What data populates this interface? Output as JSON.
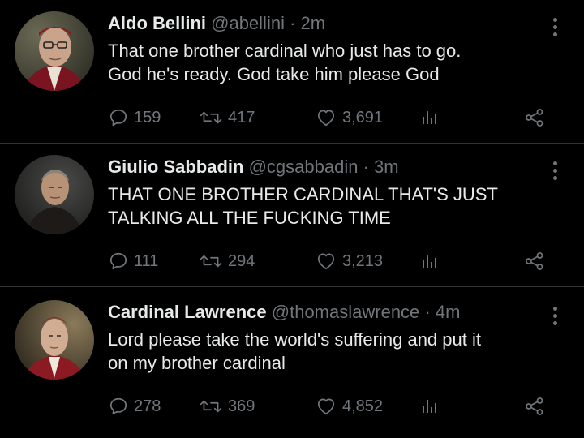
{
  "tweets": [
    {
      "name": "Aldo Bellini",
      "handle": "@abellini",
      "separator": "·",
      "time": "2m",
      "text_lines": [
        "That one brother cardinal who just has to go.",
        "God he's ready. God take him please God"
      ],
      "replies": "159",
      "retweets": "417",
      "likes": "3,691",
      "avatar_icon": "avatar-photo-aldo-bellini"
    },
    {
      "name": "Giulio Sabbadin",
      "handle": "@cgsabbadin",
      "separator": "·",
      "time": "3m",
      "text_lines": [
        "THAT ONE BROTHER CARDINAL THAT'S JUST",
        "TALKING ALL THE FUCKING TIME"
      ],
      "replies": "111",
      "retweets": "294",
      "likes": "3,213",
      "avatar_icon": "avatar-photo-giulio-sabbadin"
    },
    {
      "name": "Cardinal Lawrence",
      "handle": "@thomaslawrence",
      "separator": "·",
      "time": "4m",
      "text_lines": [
        "Lord please take the world's suffering and put it",
        "on my brother cardinal"
      ],
      "replies": "278",
      "retweets": "369",
      "likes": "4,852",
      "avatar_icon": "avatar-photo-cardinal-lawrence"
    }
  ],
  "icons": {
    "reply": "reply-bubble-icon",
    "retweet": "retweet-arrows-icon",
    "like": "heart-icon",
    "views": "views-bar-chart-icon",
    "share": "share-nodes-icon",
    "more": "more-vertical-dots-icon"
  },
  "colors": {
    "background": "#000000",
    "text": "#e7e9ea",
    "secondary": "#71767b",
    "divider": "#2f3336"
  }
}
